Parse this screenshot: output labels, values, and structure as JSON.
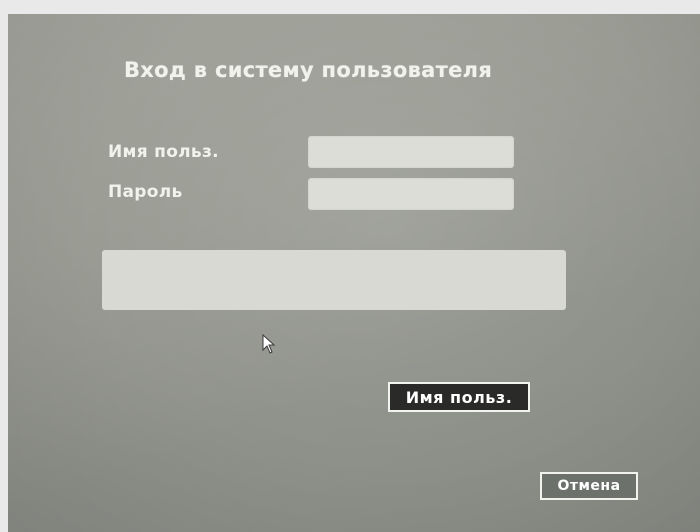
{
  "dialog": {
    "title": "Вход в систему пользователя",
    "username_label": "Имя польз.",
    "password_label": "Пароль",
    "username_value": "",
    "password_value": "",
    "message": ""
  },
  "buttons": {
    "username_button_label": "Имя польз.",
    "cancel_label": "Отмена"
  },
  "icons": {
    "cursor": "mouse-pointer-icon"
  }
}
